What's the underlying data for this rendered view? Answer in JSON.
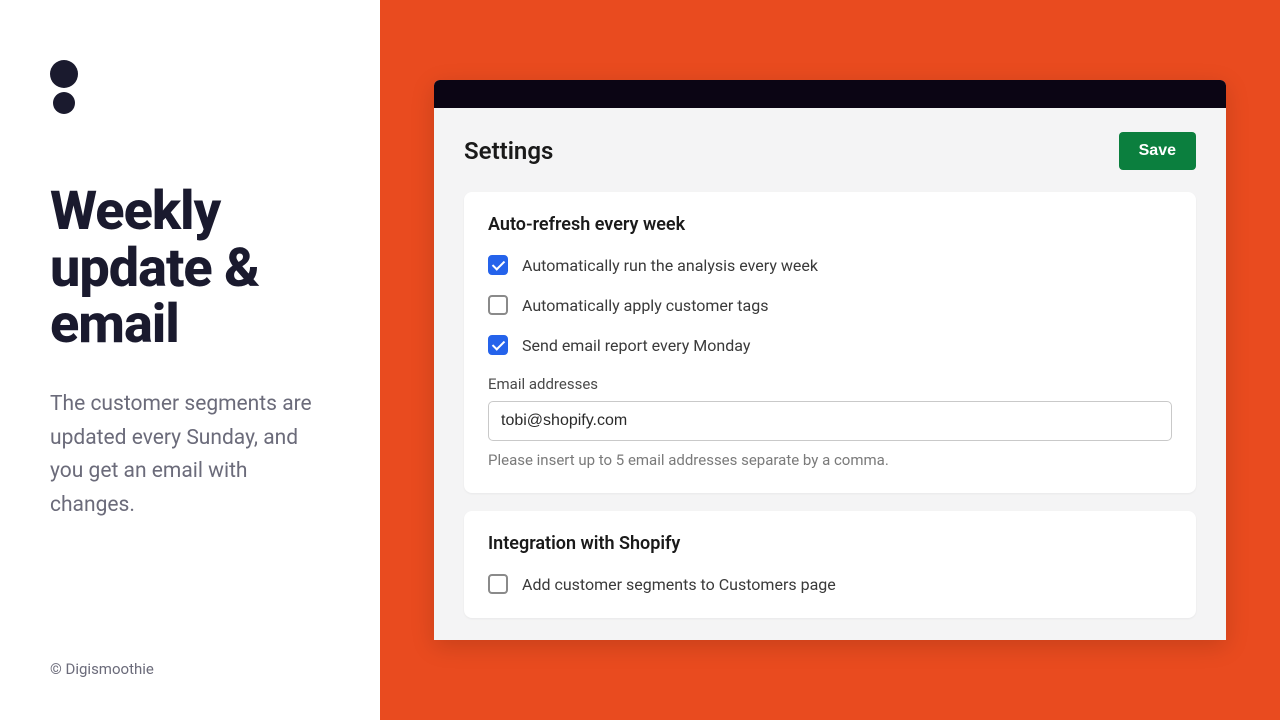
{
  "left": {
    "headline": "Weekly update & email",
    "subtext": "The customer segments are updated every Sunday, and you get an email with changes.",
    "copyright": "© Digismoothie"
  },
  "app": {
    "title": "Settings",
    "save_label": "Save",
    "section1": {
      "title": "Auto-refresh every week",
      "opt_run": "Automatically run the analysis every week",
      "opt_tags": "Automatically apply customer tags",
      "opt_email": "Send email report every Monday",
      "email_label": "Email addresses",
      "email_value": "tobi@shopify.com",
      "email_helper": "Please insert up to 5 email addresses separate by a comma."
    },
    "section2": {
      "title": "Integration with Shopify",
      "opt_add": "Add customer segments to Customers page"
    }
  }
}
